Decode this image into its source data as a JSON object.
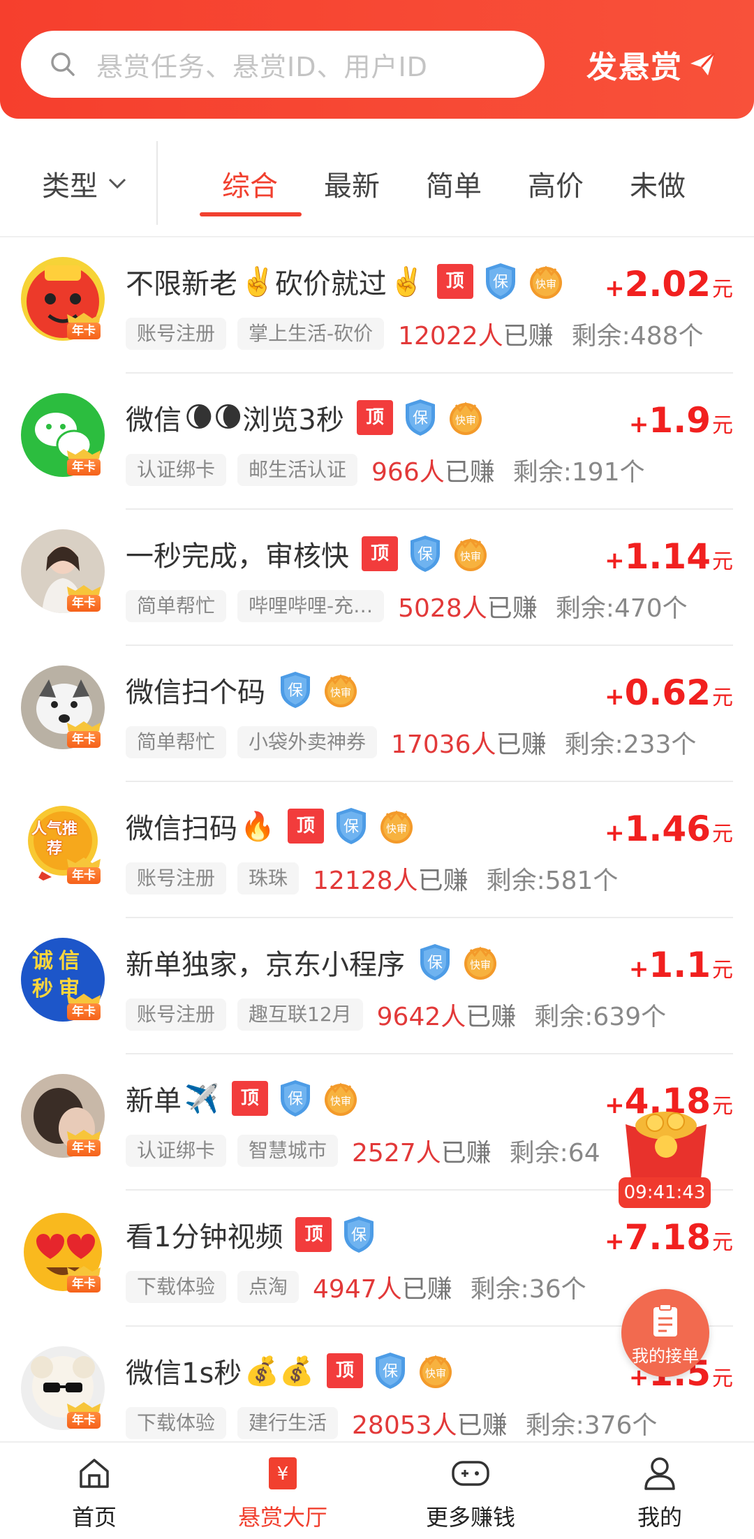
{
  "header": {
    "search_placeholder": "悬赏任务、悬赏ID、用户ID",
    "post_label": "发悬赏"
  },
  "filter": {
    "type_label": "类型",
    "tabs": [
      "综合",
      "最新",
      "简单",
      "高价",
      "未做"
    ],
    "active_tab": 0
  },
  "badges": {
    "year_card": "年卡",
    "top": "顶",
    "guarantee": "保",
    "fast": "快审"
  },
  "tasks": [
    {
      "title": "不限新老",
      "emoji": "✌️",
      "title2": "砍价就过",
      "emoji2": "✌️",
      "top": true,
      "guarantee": true,
      "fast": true,
      "plus": "+",
      "reward": "2.02",
      "unit": "元",
      "tags": [
        "账号注册",
        "掌上生活-砍价"
      ],
      "earned": "12022人",
      "earned_suffix": "已赚",
      "remaining": "剩余:488个",
      "avatar": "red-envelope-face"
    },
    {
      "title": "微信",
      "emoji": "🌘🌘",
      "title2": "浏览3秒",
      "emoji2": "",
      "top": true,
      "guarantee": true,
      "fast": true,
      "plus": "+",
      "reward": "1.9",
      "unit": "元",
      "tags": [
        "认证绑卡",
        "邮生活认证"
      ],
      "earned": "966人",
      "earned_suffix": "已赚",
      "remaining": "剩余:191个",
      "avatar": "wechat-logo"
    },
    {
      "title": "一秒完成，审核快",
      "emoji": "",
      "title2": "",
      "emoji2": "",
      "top": true,
      "guarantee": true,
      "fast": true,
      "plus": "+",
      "reward": "1.14",
      "unit": "元",
      "tags": [
        "简单帮忙",
        "哔哩哔哩-充…"
      ],
      "earned": "5028人",
      "earned_suffix": "已赚",
      "remaining": "剩余:470个",
      "avatar": "girl-photo"
    },
    {
      "title": "微信扫个码",
      "emoji": "",
      "title2": "",
      "emoji2": "",
      "top": false,
      "guarantee": true,
      "fast": true,
      "plus": "+",
      "reward": "0.62",
      "unit": "元",
      "tags": [
        "简单帮忙",
        "小袋外卖神券"
      ],
      "earned": "17036人",
      "earned_suffix": "已赚",
      "remaining": "剩余:233个",
      "avatar": "dog-photo"
    },
    {
      "title": "微信扫码",
      "emoji": "🔥",
      "title2": "",
      "emoji2": "",
      "top": true,
      "guarantee": true,
      "fast": true,
      "plus": "+",
      "reward": "1.46",
      "unit": "元",
      "tags": [
        "账号注册",
        "珠珠"
      ],
      "earned": "12128人",
      "earned_suffix": "已赚",
      "remaining": "剩余:581个",
      "avatar": "popular-medal",
      "avatar_text": "人气推荐"
    },
    {
      "title": "新单独家，京东小程序",
      "emoji": "",
      "title2": "",
      "emoji2": "",
      "top": false,
      "guarantee": true,
      "fast": true,
      "plus": "+",
      "reward": "1.1",
      "unit": "元",
      "tags": [
        "账号注册",
        "趣互联12月"
      ],
      "earned": "9642人",
      "earned_suffix": "已赚",
      "remaining": "剩余:639个",
      "avatar": "integrity-badge",
      "avatar_text": "诚信秒审"
    },
    {
      "title": "新单",
      "emoji": "✈️",
      "title2": "",
      "emoji2": "",
      "top": true,
      "guarantee": true,
      "fast": true,
      "plus": "+",
      "reward": "4.18",
      "unit": "元",
      "tags": [
        "认证绑卡",
        "智慧城市"
      ],
      "earned": "2527人",
      "earned_suffix": "已赚",
      "remaining": "剩余:64",
      "avatar": "pet-photo"
    },
    {
      "title": "看1分钟视频",
      "emoji": "",
      "title2": "",
      "emoji2": "",
      "top": true,
      "guarantee": true,
      "fast": false,
      "plus": "+",
      "reward": "7.18",
      "unit": "元",
      "tags": [
        "下载体验",
        "点淘"
      ],
      "earned": "4947人",
      "earned_suffix": "已赚",
      "remaining": "剩余:36个",
      "avatar": "heart-eyes-emoji"
    },
    {
      "title": "微信1s秒",
      "emoji": "💰💰",
      "title2": "",
      "emoji2": "",
      "top": true,
      "guarantee": true,
      "fast": true,
      "plus": "+",
      "reward": "1.5",
      "unit": "元",
      "tags": [
        "下载体验",
        "建行生活"
      ],
      "earned": "28053人",
      "earned_suffix": "已赚",
      "remaining": "剩余:376个",
      "avatar": "sheep-sunglasses"
    }
  ],
  "floating": {
    "timer": "09:41:43",
    "my_tasks": "我的接单"
  },
  "nav": [
    {
      "label": "首页",
      "icon": "home-icon"
    },
    {
      "label": "悬赏大厅",
      "icon": "bounty-hall-icon",
      "active": true
    },
    {
      "label": "更多赚钱",
      "icon": "gamepad-icon"
    },
    {
      "label": "我的",
      "icon": "user-icon"
    }
  ],
  "colors": {
    "brand": "#f1402f",
    "reward": "#f1201f",
    "earned": "#e23939"
  }
}
